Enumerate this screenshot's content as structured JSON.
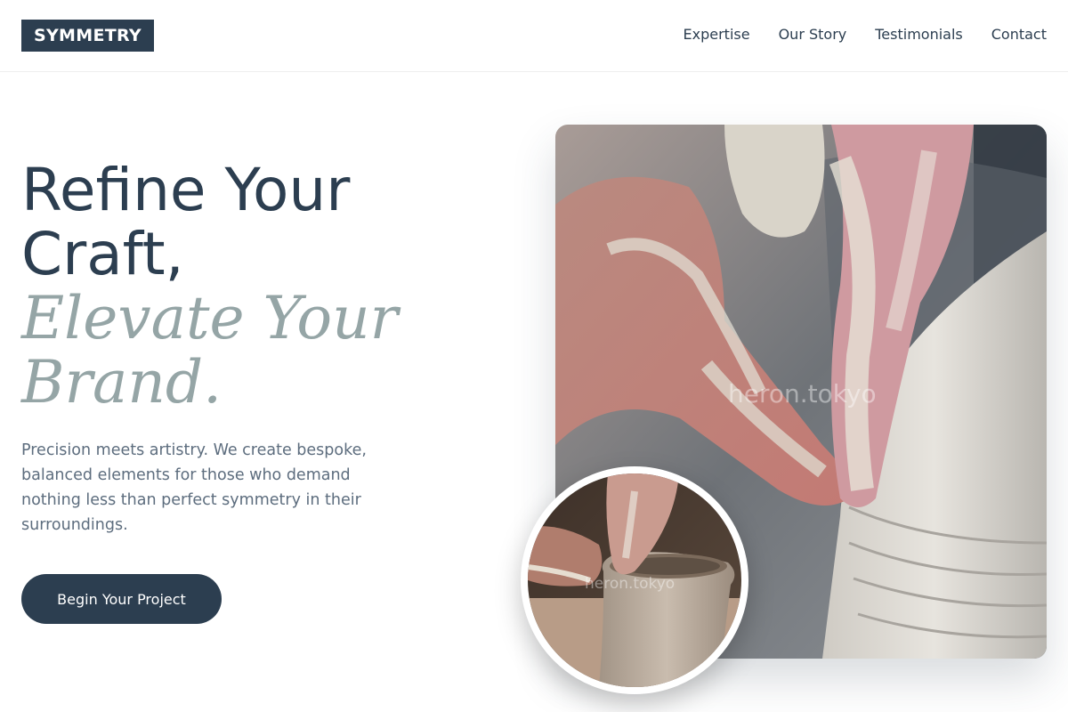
{
  "header": {
    "logo": "SYMMETRY",
    "nav": [
      {
        "label": "Expertise"
      },
      {
        "label": "Our Story"
      },
      {
        "label": "Testimonials"
      },
      {
        "label": "Contact"
      }
    ]
  },
  "hero": {
    "title_line1": "Refine Your Craft,",
    "title_line2": "Elevate Your Brand.",
    "description": "Precision meets artistry. We create bespoke, balanced elements for those who demand nothing less than perfect symmetry in their surroundings.",
    "cta_label": "Begin Your Project"
  },
  "images": {
    "main_watermark": "heron.tokyo",
    "circle_watermark": "heron.tokyo"
  },
  "colors": {
    "primary": "#2c3e50",
    "accent_muted": "#95a5a6",
    "body_text": "#5d6d7e",
    "background": "#ffffff"
  }
}
